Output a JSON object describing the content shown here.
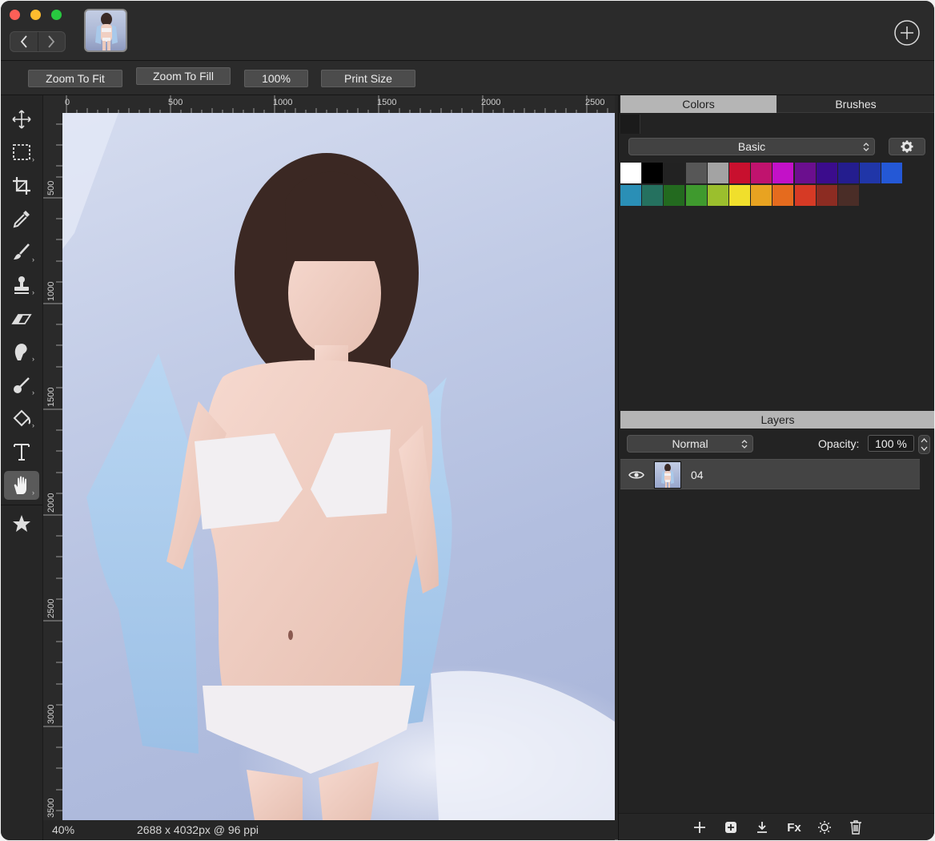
{
  "window": {
    "traffic_lights": {
      "close": "#fe5f57",
      "minimize": "#febc2e",
      "zoom": "#28c840"
    }
  },
  "titlebar": {
    "back_icon": "chevron-left-icon",
    "forward_icon": "chevron-right-icon",
    "add_icon": "plus-circle-icon"
  },
  "toolbar": {
    "zoom_to_fit": "Zoom To Fit",
    "zoom_to_fill": "Zoom To Fill",
    "actual_size": "100%",
    "print_size": "Print Size"
  },
  "tools": [
    {
      "name": "move-icon"
    },
    {
      "name": "marquee-select-icon"
    },
    {
      "name": "crop-icon"
    },
    {
      "name": "eyedropper-icon"
    },
    {
      "name": "brush-icon"
    },
    {
      "name": "clone-stamp-icon"
    },
    {
      "name": "eraser-icon"
    },
    {
      "name": "smudge-icon"
    },
    {
      "name": "dodge-icon"
    },
    {
      "name": "paint-bucket-icon"
    },
    {
      "name": "text-icon"
    },
    {
      "name": "hand-icon",
      "active": true
    },
    {
      "name": "star-icon"
    }
  ],
  "rulers": {
    "top": [
      "0",
      "500",
      "1000",
      "1500",
      "2000",
      "2500"
    ],
    "left": [
      "500",
      "1000",
      "1500",
      "2000",
      "2500",
      "3000",
      "3500"
    ]
  },
  "status": {
    "zoom": "40%",
    "dimensions": "2688 x 4032px @ 96 ppi"
  },
  "colors_panel": {
    "tab_colors": "Colors",
    "tab_brushes": "Brushes",
    "palette_name": "Basic",
    "settings_icon": "gear-icon",
    "current_color": "#1b1b1b",
    "swatches": [
      "#ffffff",
      "#000000",
      "#222222",
      "#575757",
      "#a3a3a3",
      "#c8102e",
      "#c0136e",
      "#c311c8",
      "#6b0f8e",
      "#3b0c8c",
      "#241d8e",
      "#2036a8",
      "#2458d6",
      "#2a8fb6",
      "#25715f",
      "#236a1f",
      "#3f9a2e",
      "#9bbf2d",
      "#f0df2c",
      "#e8a321",
      "#e56b1e",
      "#d63a25",
      "#8c2c22",
      "#4a2d27"
    ]
  },
  "layers_panel": {
    "title": "Layers",
    "blend_mode": "Normal",
    "opacity_label": "Opacity:",
    "opacity_value": "100 %",
    "layers": [
      {
        "name": "04",
        "visible": true
      }
    ],
    "bottom_actions": [
      "add-layer-icon",
      "add-group-icon",
      "merge-down-icon",
      "fx-icon",
      "adjustments-icon",
      "trash-icon"
    ],
    "fx_label": "Fx"
  }
}
